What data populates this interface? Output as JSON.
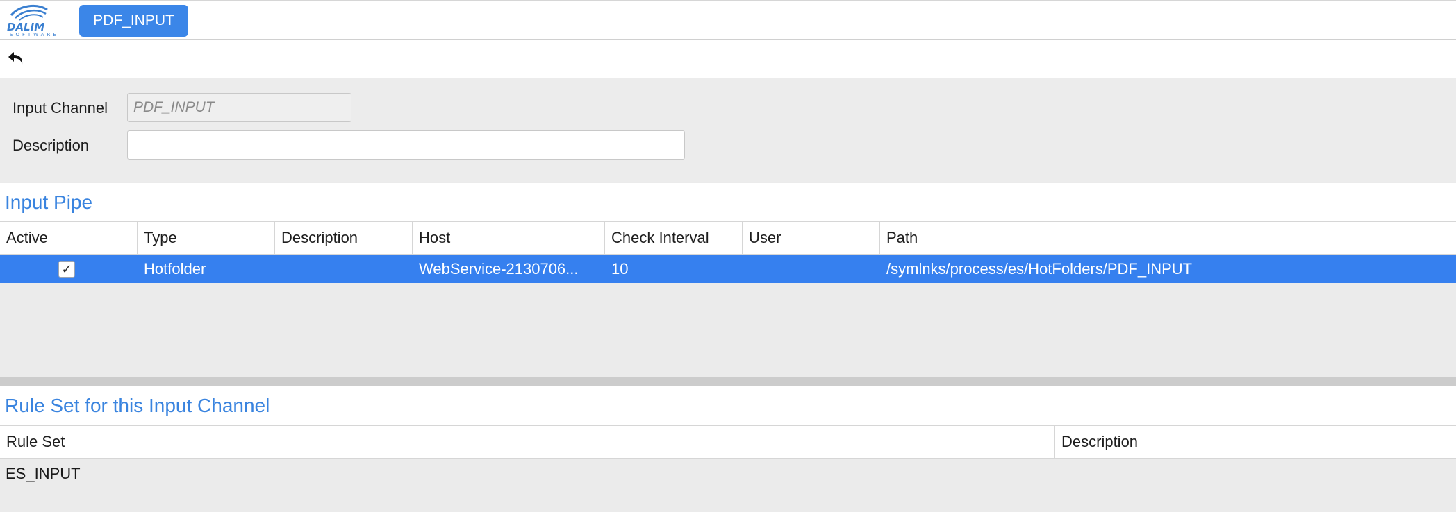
{
  "header": {
    "logo_text": "DALIM",
    "logo_subtext": "SOFTWARE",
    "active_tab": "PDF_INPUT"
  },
  "toolbar": {
    "back_icon": "undo-arrow-icon"
  },
  "form": {
    "input_channel_label": "Input Channel",
    "input_channel_value": "PDF_INPUT",
    "description_label": "Description",
    "description_value": ""
  },
  "input_pipe": {
    "title": "Input Pipe",
    "columns": [
      "Active",
      "Type",
      "Description",
      "Host",
      "Check Interval",
      "User",
      "Path"
    ],
    "rows": [
      {
        "active": true,
        "type": "Hotfolder",
        "description": "",
        "host": "WebService-2130706...",
        "check_interval": "10",
        "user": "",
        "path": "/symlnks/process/es/HotFolders/PDF_INPUT"
      }
    ]
  },
  "rule_set": {
    "title": "Rule Set for this Input Channel",
    "columns": [
      "Rule Set",
      "Description"
    ],
    "rows": [
      {
        "rule_set": "ES_INPUT",
        "description": ""
      }
    ]
  },
  "colors": {
    "accent": "#3b86e8",
    "selection": "#3680ef",
    "section_title": "#3a84df"
  }
}
